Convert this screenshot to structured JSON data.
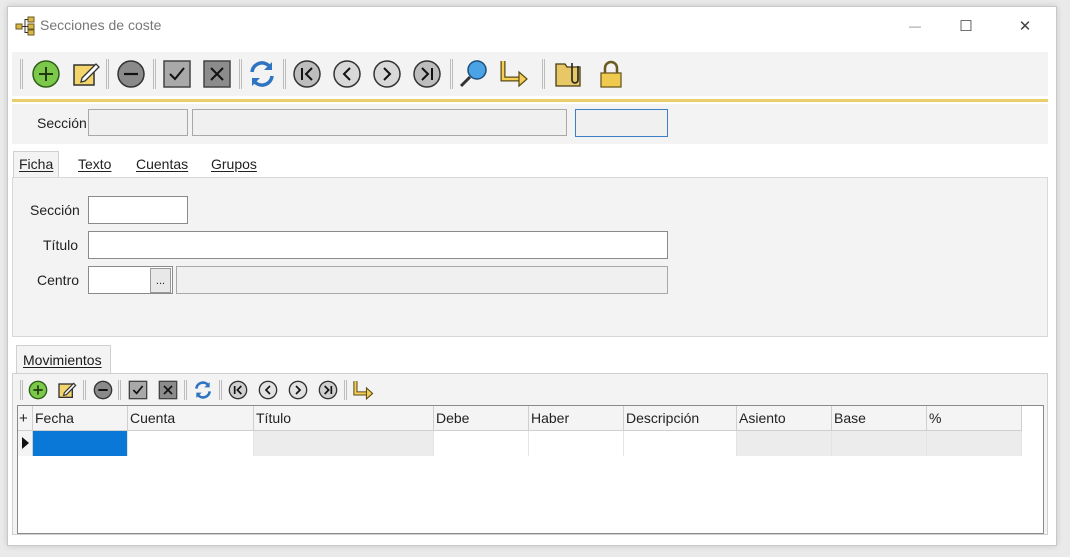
{
  "window": {
    "title": "Secciones de coste",
    "minimize_glyph": "—",
    "maximize_glyph": "☐",
    "close_glyph": "✕"
  },
  "toolbar": {
    "buttons": [
      {
        "name": "add-record-icon"
      },
      {
        "name": "edit-record-icon"
      },
      {
        "name": "delete-record-icon"
      },
      {
        "name": "confirm-icon"
      },
      {
        "name": "cancel-icon"
      },
      {
        "name": "refresh-icon"
      },
      {
        "name": "first-record-icon"
      },
      {
        "name": "previous-record-icon"
      },
      {
        "name": "next-record-icon"
      },
      {
        "name": "last-record-icon"
      },
      {
        "name": "search-icon"
      },
      {
        "name": "jump-arrow-icon"
      },
      {
        "name": "attachments-folder-icon"
      },
      {
        "name": "lock-icon"
      }
    ]
  },
  "header": {
    "seccion_label": "Sección",
    "seccion_code": "",
    "seccion_desc": "",
    "seccion_extra": ""
  },
  "tabs": [
    {
      "label": "Ficha",
      "active": true
    },
    {
      "label": "Texto",
      "active": false
    },
    {
      "label": "Cuentas",
      "active": false
    },
    {
      "label": "Grupos",
      "active": false
    }
  ],
  "form": {
    "seccion_label": "Sección",
    "seccion_value": "",
    "titulo_label": "Título",
    "titulo_value": "",
    "centro_label": "Centro",
    "centro_value": "",
    "centro_button": "...",
    "centro_desc": ""
  },
  "movimientos": {
    "tab_label": "Movimientos",
    "add_row_glyph": "+",
    "columns": [
      "Fecha",
      "Cuenta",
      "Título",
      "Debe",
      "Haber",
      "Descripción",
      "Asiento",
      "Base",
      "%"
    ],
    "rows": [
      [
        "",
        "",
        "",
        "",
        "",
        "",
        "",
        "",
        ""
      ]
    ]
  },
  "colors": {
    "accent_gold": "#e9cf6b",
    "selection_blue": "#0a78d7",
    "focus_border": "#3b7fc4"
  }
}
